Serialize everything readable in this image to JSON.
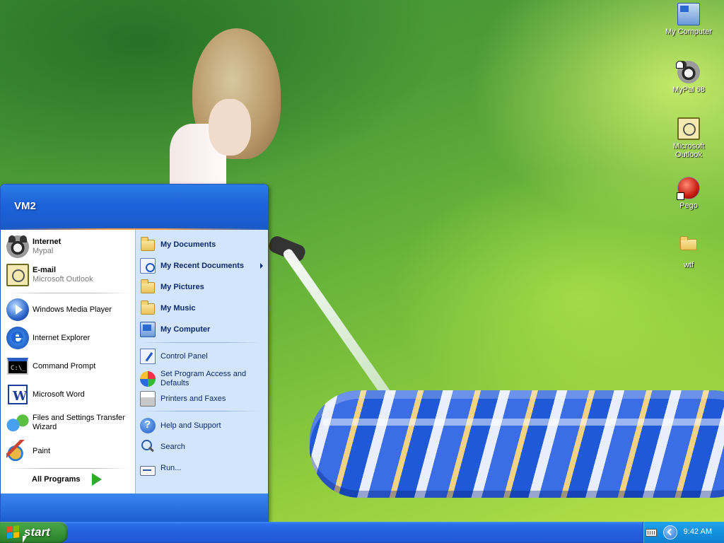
{
  "desktop": {
    "icons": [
      {
        "label": "My Computer",
        "icon": "my-computer-icon"
      },
      {
        "label": "MyPal 68",
        "icon": "mypal-icon"
      },
      {
        "label": "Microsoft Outlook",
        "icon": "outlook-icon"
      },
      {
        "label": "Pego",
        "icon": "pego-icon"
      },
      {
        "label": "wtf",
        "icon": "folder-icon"
      }
    ]
  },
  "start_menu": {
    "user_name": "VM2",
    "pinned": [
      {
        "title": "Internet",
        "subtitle": "Mypal",
        "icon": "mypal-icon"
      },
      {
        "title": "E-mail",
        "subtitle": "Microsoft Outlook",
        "icon": "outlook-icon"
      }
    ],
    "recent": [
      {
        "title": "Windows Media Player",
        "icon": "media-player-icon"
      },
      {
        "title": "Internet Explorer",
        "icon": "internet-explorer-icon"
      },
      {
        "title": "Command Prompt",
        "icon": "command-prompt-icon"
      },
      {
        "title": "Microsoft Word",
        "icon": "word-icon"
      },
      {
        "title": "Files and Settings Transfer Wizard",
        "icon": "transfer-wizard-icon"
      },
      {
        "title": "Paint",
        "icon": "paint-icon"
      }
    ],
    "all_programs": "All Programs",
    "places": [
      {
        "label": "My Documents",
        "icon": "my-documents-icon"
      },
      {
        "label": "My Recent Documents",
        "icon": "recent-documents-icon"
      },
      {
        "label": "My Pictures",
        "icon": "my-pictures-icon"
      },
      {
        "label": "My Music",
        "icon": "my-music-icon"
      },
      {
        "label": "My Computer",
        "icon": "my-computer-icon"
      }
    ],
    "settings": [
      {
        "label": "Control Panel",
        "icon": "control-panel-icon"
      },
      {
        "label": "Set Program Access and Defaults",
        "icon": "program-access-icon"
      },
      {
        "label": "Printers and Faxes",
        "icon": "printer-icon"
      }
    ],
    "tools": [
      {
        "label": "Help and Support",
        "icon": "help-icon"
      },
      {
        "label": "Search",
        "icon": "search-icon"
      },
      {
        "label": "Run...",
        "icon": "run-icon"
      }
    ]
  },
  "taskbar": {
    "start_label": "start",
    "clock": "9:42 AM"
  },
  "colors": {
    "taskbar_blue": "#245fde",
    "start_green": "#3c9a3c",
    "menu_right_panel": "#d3e5fa",
    "tray_blue": "#1390e0"
  }
}
